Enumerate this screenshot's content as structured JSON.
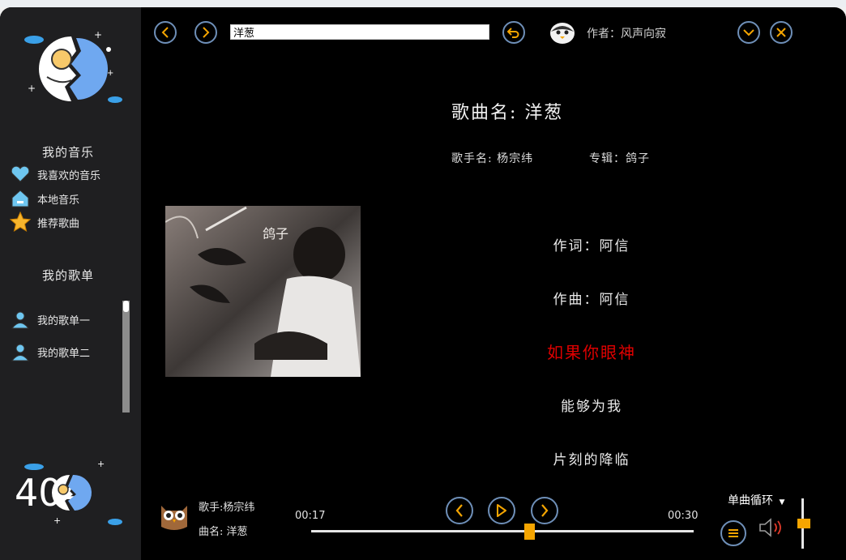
{
  "sidebar": {
    "my_music_title": "我的音乐",
    "items": [
      {
        "label": "我喜欢的音乐",
        "icon": "heart-icon"
      },
      {
        "label": "本地音乐",
        "icon": "home-icon"
      },
      {
        "label": "推荐歌曲",
        "icon": "star-icon"
      }
    ],
    "playlists_title": "我的歌单",
    "playlists": [
      {
        "label": "我的歌单一",
        "icon": "user-icon"
      },
      {
        "label": "我的歌单二",
        "icon": "user-icon"
      }
    ],
    "logo_text": "404"
  },
  "topbar": {
    "search_value": "洋葱",
    "author": "作者：风声向寂"
  },
  "song": {
    "title": "歌曲名:  洋葱",
    "singer": "歌手名:   杨宗纬",
    "album": "专辑：鸽子",
    "cover_text": "鸽子"
  },
  "lyrics": {
    "lines": [
      "作词：阿信",
      "作曲：阿信",
      "如果你眼神",
      "能够为我",
      "片刻的降临"
    ],
    "current_index": 2
  },
  "player": {
    "singer": "歌手:杨宗纬",
    "song_name": "曲名: 洋葱",
    "time_current": "00:17",
    "time_total": "00:30",
    "progress": 0.57,
    "play_mode": "单曲循环",
    "volume": 0.5
  },
  "colors": {
    "accent": "#f5a500",
    "current_lyric": "#e00000",
    "button_ring": "#6e8fb8",
    "sidebar_bg": "#1f1f21"
  }
}
